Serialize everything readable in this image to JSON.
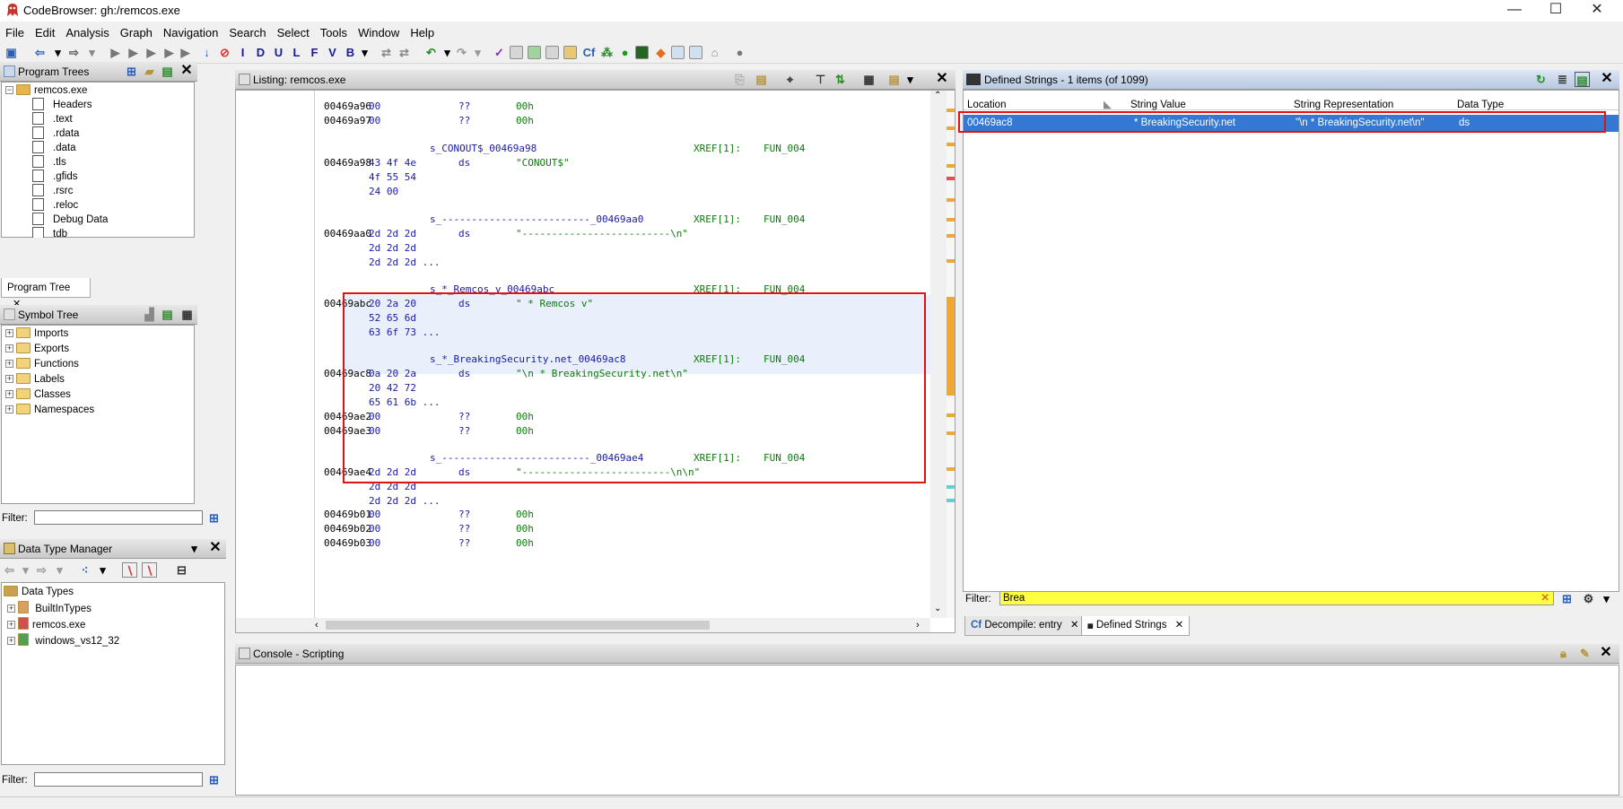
{
  "window": {
    "title": "CodeBrowser: gh:/remcos.exe",
    "minimize": "—",
    "maximize": "☐",
    "close": "✕"
  },
  "menu": [
    "File",
    "Edit",
    "Analysis",
    "Graph",
    "Navigation",
    "Search",
    "Select",
    "Tools",
    "Window",
    "Help"
  ],
  "toolbar_letters": [
    "I",
    "D",
    "U",
    "L",
    "F",
    "V",
    "B"
  ],
  "program_trees": {
    "title": "Program Trees",
    "root": "remcos.exe",
    "items": [
      "Headers",
      ".text",
      ".rdata",
      ".data",
      ".tls",
      ".gfids",
      ".rsrc",
      ".reloc",
      "Debug Data",
      "tdb"
    ],
    "tab": "Program Tree"
  },
  "symbol_tree": {
    "title": "Symbol Tree",
    "items": [
      "Imports",
      "Exports",
      "Functions",
      "Labels",
      "Classes",
      "Namespaces"
    ],
    "filter_label": "Filter:"
  },
  "data_type_manager": {
    "title": "Data Type Manager",
    "root": "Data Types",
    "items": [
      "BuiltInTypes",
      "remcos.exe",
      "windows_vs12_32"
    ],
    "filter_label": "Filter:"
  },
  "listing": {
    "title": "Listing:  remcos.exe",
    "rows": [
      {
        "type": "code",
        "addr": "00469a96",
        "bytes": "00",
        "mnem": "??",
        "oper": "00h"
      },
      {
        "type": "code",
        "addr": "00469a97",
        "bytes": "00",
        "mnem": "??",
        "oper": "00h"
      },
      {
        "type": "label",
        "label": "s_CONOUT$_00469a98",
        "xref": "XREF[1]:",
        "fun": "FUN_004"
      },
      {
        "type": "code",
        "addr": "00469a98",
        "bytes": "43 4f 4e",
        "mnem": "ds",
        "oper": "\"CONOUT$\""
      },
      {
        "type": "cont",
        "bytes": "4f 55 54"
      },
      {
        "type": "cont",
        "bytes": "24 00"
      },
      {
        "type": "label",
        "label": "s_-------------------------_00469aa0",
        "xref": "XREF[1]:",
        "fun": "FUN_004"
      },
      {
        "type": "code",
        "addr": "00469aa0",
        "bytes": "2d 2d 2d",
        "mnem": "ds",
        "oper": "\"-------------------------\\n\""
      },
      {
        "type": "cont",
        "bytes": "2d 2d 2d"
      },
      {
        "type": "cont",
        "bytes": "2d 2d 2d ..."
      },
      {
        "type": "label",
        "label": "s_*_Remcos_v_00469abc",
        "xref": "XREF[1]:",
        "fun": "FUN_004"
      },
      {
        "type": "code",
        "addr": "00469abc",
        "bytes": "20 2a 20",
        "mnem": "ds",
        "oper": "\" * Remcos v\""
      },
      {
        "type": "cont",
        "bytes": "52 65 6d"
      },
      {
        "type": "cont",
        "bytes": "63 6f 73 ..."
      },
      {
        "type": "label",
        "label": "s_*_BreakingSecurity.net_00469ac8",
        "xref": "XREF[1]:",
        "fun": "FUN_004"
      },
      {
        "type": "code",
        "addr": "00469ac8",
        "bytes": "0a 20 2a",
        "mnem": "ds",
        "oper": "\"\\n * BreakingSecurity.net\\n\""
      },
      {
        "type": "cont",
        "bytes": "20 42 72"
      },
      {
        "type": "cont",
        "bytes": "65 61 6b ..."
      },
      {
        "type": "code",
        "addr": "00469ae2",
        "bytes": "00",
        "mnem": "??",
        "oper": "00h"
      },
      {
        "type": "code",
        "addr": "00469ae3",
        "bytes": "00",
        "mnem": "??",
        "oper": "00h"
      },
      {
        "type": "label",
        "label": "s_-------------------------_00469ae4",
        "xref": "XREF[1]:",
        "fun": "FUN_004"
      },
      {
        "type": "code",
        "addr": "00469ae4",
        "bytes": "2d 2d 2d",
        "mnem": "ds",
        "oper": "\"-------------------------\\n\\n\""
      },
      {
        "type": "cont",
        "bytes": "2d 2d 2d"
      },
      {
        "type": "cont",
        "bytes": "2d 2d 2d ..."
      },
      {
        "type": "code",
        "addr": "00469b01",
        "bytes": "00",
        "mnem": "??",
        "oper": "00h"
      },
      {
        "type": "code",
        "addr": "00469b02",
        "bytes": "00",
        "mnem": "??",
        "oper": "00h"
      },
      {
        "type": "code",
        "addr": "00469b03",
        "bytes": "00",
        "mnem": "??",
        "oper": "00h"
      }
    ]
  },
  "defined_strings": {
    "title": "Defined Strings - 1 items (of 1099)",
    "columns": [
      "Location",
      "String Value",
      "String Representation",
      "Data Type"
    ],
    "rows": [
      {
        "location": "00469ac8",
        "value": "* BreakingSecurity.net",
        "repr": "\"\\n * BreakingSecurity.net\\n\"",
        "dtype": "ds"
      }
    ],
    "filter_label": "Filter:",
    "filter_value": "Brea",
    "tabs": [
      "Decompile: entry",
      "Defined Strings"
    ]
  },
  "console": {
    "title": "Console - Scripting"
  },
  "colors": {
    "selection": "#3478d4",
    "highlight_box": "#e01212",
    "filter_bg": "#ffff40"
  }
}
